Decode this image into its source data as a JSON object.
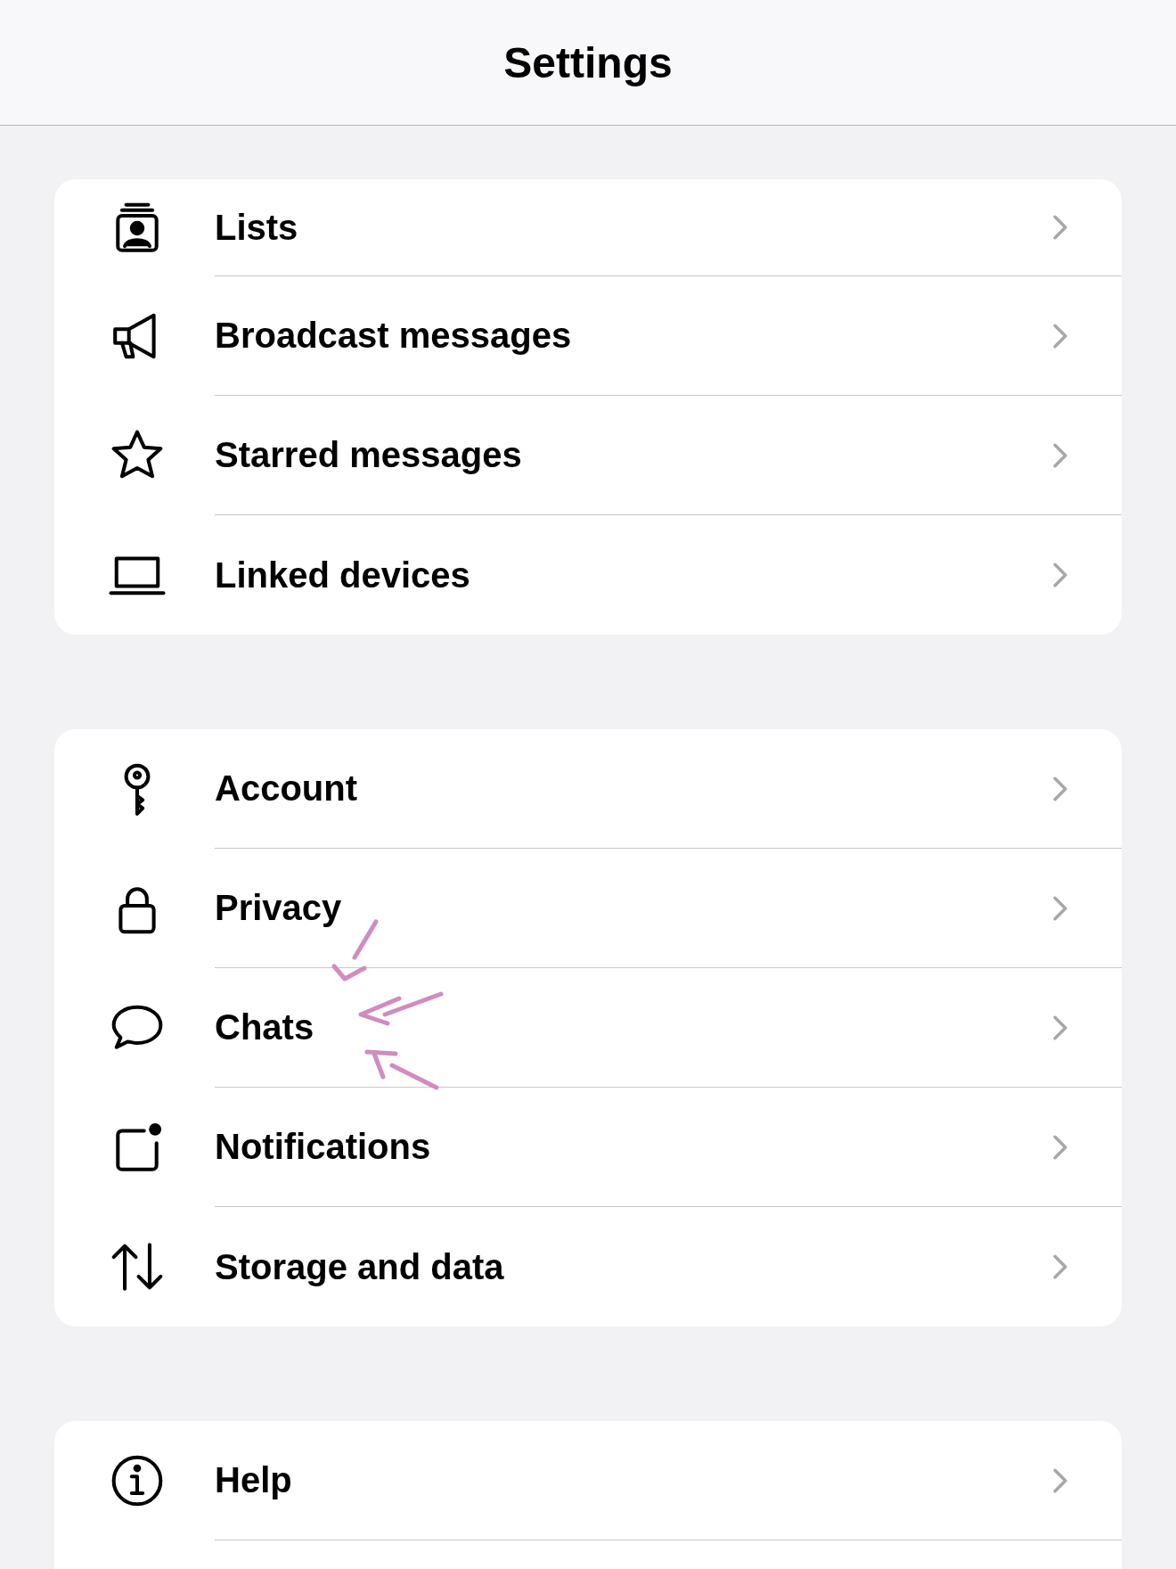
{
  "header": {
    "title": "Settings"
  },
  "groups": [
    {
      "items": [
        {
          "label": "Lists"
        },
        {
          "label": "Broadcast messages"
        },
        {
          "label": "Starred messages"
        },
        {
          "label": "Linked devices"
        }
      ]
    },
    {
      "items": [
        {
          "label": "Account"
        },
        {
          "label": "Privacy"
        },
        {
          "label": "Chats"
        },
        {
          "label": "Notifications"
        },
        {
          "label": "Storage and data"
        }
      ]
    },
    {
      "items": [
        {
          "label": "Help"
        }
      ],
      "cut_off": true
    }
  ]
}
